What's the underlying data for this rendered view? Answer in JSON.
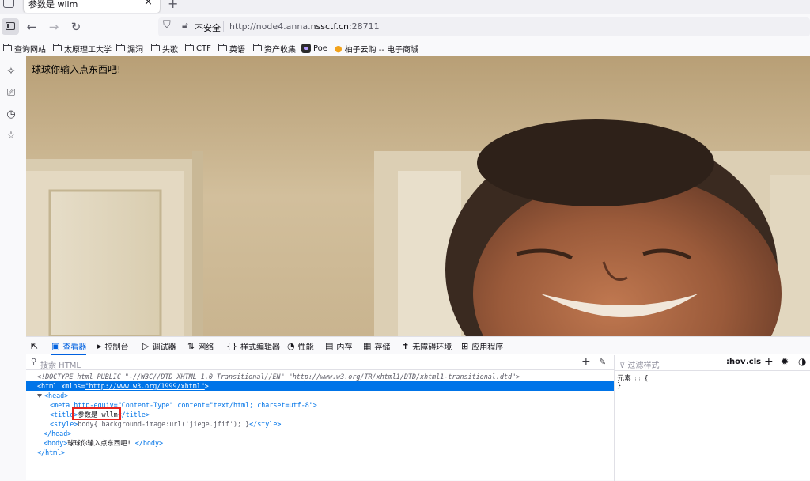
{
  "tab": {
    "title": "参数是 wllm",
    "close_glyph": "×",
    "new_tab_glyph": "+"
  },
  "navbar": {
    "back_glyph": "←",
    "forward_glyph": "→",
    "reload_glyph": "↻",
    "security_label": "不安全",
    "url_scheme": "http://node4.anna.",
    "url_host": "nssctf.cn",
    "url_port": ":28711"
  },
  "bookmarks": [
    {
      "label": "查询网站",
      "icon": "folder-icon"
    },
    {
      "label": "太原理工大学",
      "icon": "folder-icon"
    },
    {
      "label": "漏洞",
      "icon": "folder-icon"
    },
    {
      "label": "头歌",
      "icon": "folder-icon"
    },
    {
      "label": "CTF",
      "icon": "folder-icon"
    },
    {
      "label": "英语",
      "icon": "folder-icon"
    },
    {
      "label": "资产收集",
      "icon": "folder-icon"
    },
    {
      "label": "Poe",
      "icon": "poe-icon"
    },
    {
      "label": "柚子云购 -- 电子商城",
      "icon": "citrus-icon"
    }
  ],
  "page": {
    "text": "球球你输入点东西吧!"
  },
  "devtools": {
    "tabs": [
      {
        "label": "查看器",
        "icon": "inspector-icon"
      },
      {
        "label": "控制台",
        "icon": "console-icon"
      },
      {
        "label": "调试器",
        "icon": "debugger-icon"
      },
      {
        "label": "网络",
        "icon": "network-icon"
      },
      {
        "label": "样式编辑器",
        "icon": "style-editor-icon"
      },
      {
        "label": "性能",
        "icon": "performance-icon"
      },
      {
        "label": "内存",
        "icon": "memory-icon"
      },
      {
        "label": "存储",
        "icon": "storage-icon"
      },
      {
        "label": "无障碍环境",
        "icon": "accessibility-icon"
      },
      {
        "label": "应用程序",
        "icon": "application-icon"
      }
    ],
    "search_placeholder": "搜索 HTML",
    "markup": {
      "doctype": "<!DOCTYPE html PUBLIC \"-//W3C//DTD XHTML 1.0 Transitional//EN\" \"http://www.w3.org/TR/xhtml1/DTD/xhtml1-transitional.dtd\">",
      "html_open_tag": "<html",
      "html_attr": " xmlns=",
      "html_val": "\"http://www.w3.org/1999/xhtml\"",
      "html_close_bracket": ">",
      "head_open": "<head>",
      "meta_line": "<meta http-equiv=\"Content-Type\" content=\"text/html; charset=utf-8\">",
      "title_open": "<title>",
      "title_text": "参数是 wllm",
      "title_close": "</title>",
      "style_open": "<style>",
      "style_text": "body{ background-image:url('jiege.jfif'); }",
      "style_close": "</style>",
      "head_close": "</head>",
      "body_open": "<body>",
      "body_text": "球球你输入点东西吧! ",
      "body_close": "</body>",
      "html_close": "</html>"
    },
    "rules": {
      "filter_placeholder": "过滤样式",
      "hov": ":hov",
      "cls": ".cls",
      "element_rule": "元素 ⬚ {",
      "close_brace": "}"
    }
  }
}
